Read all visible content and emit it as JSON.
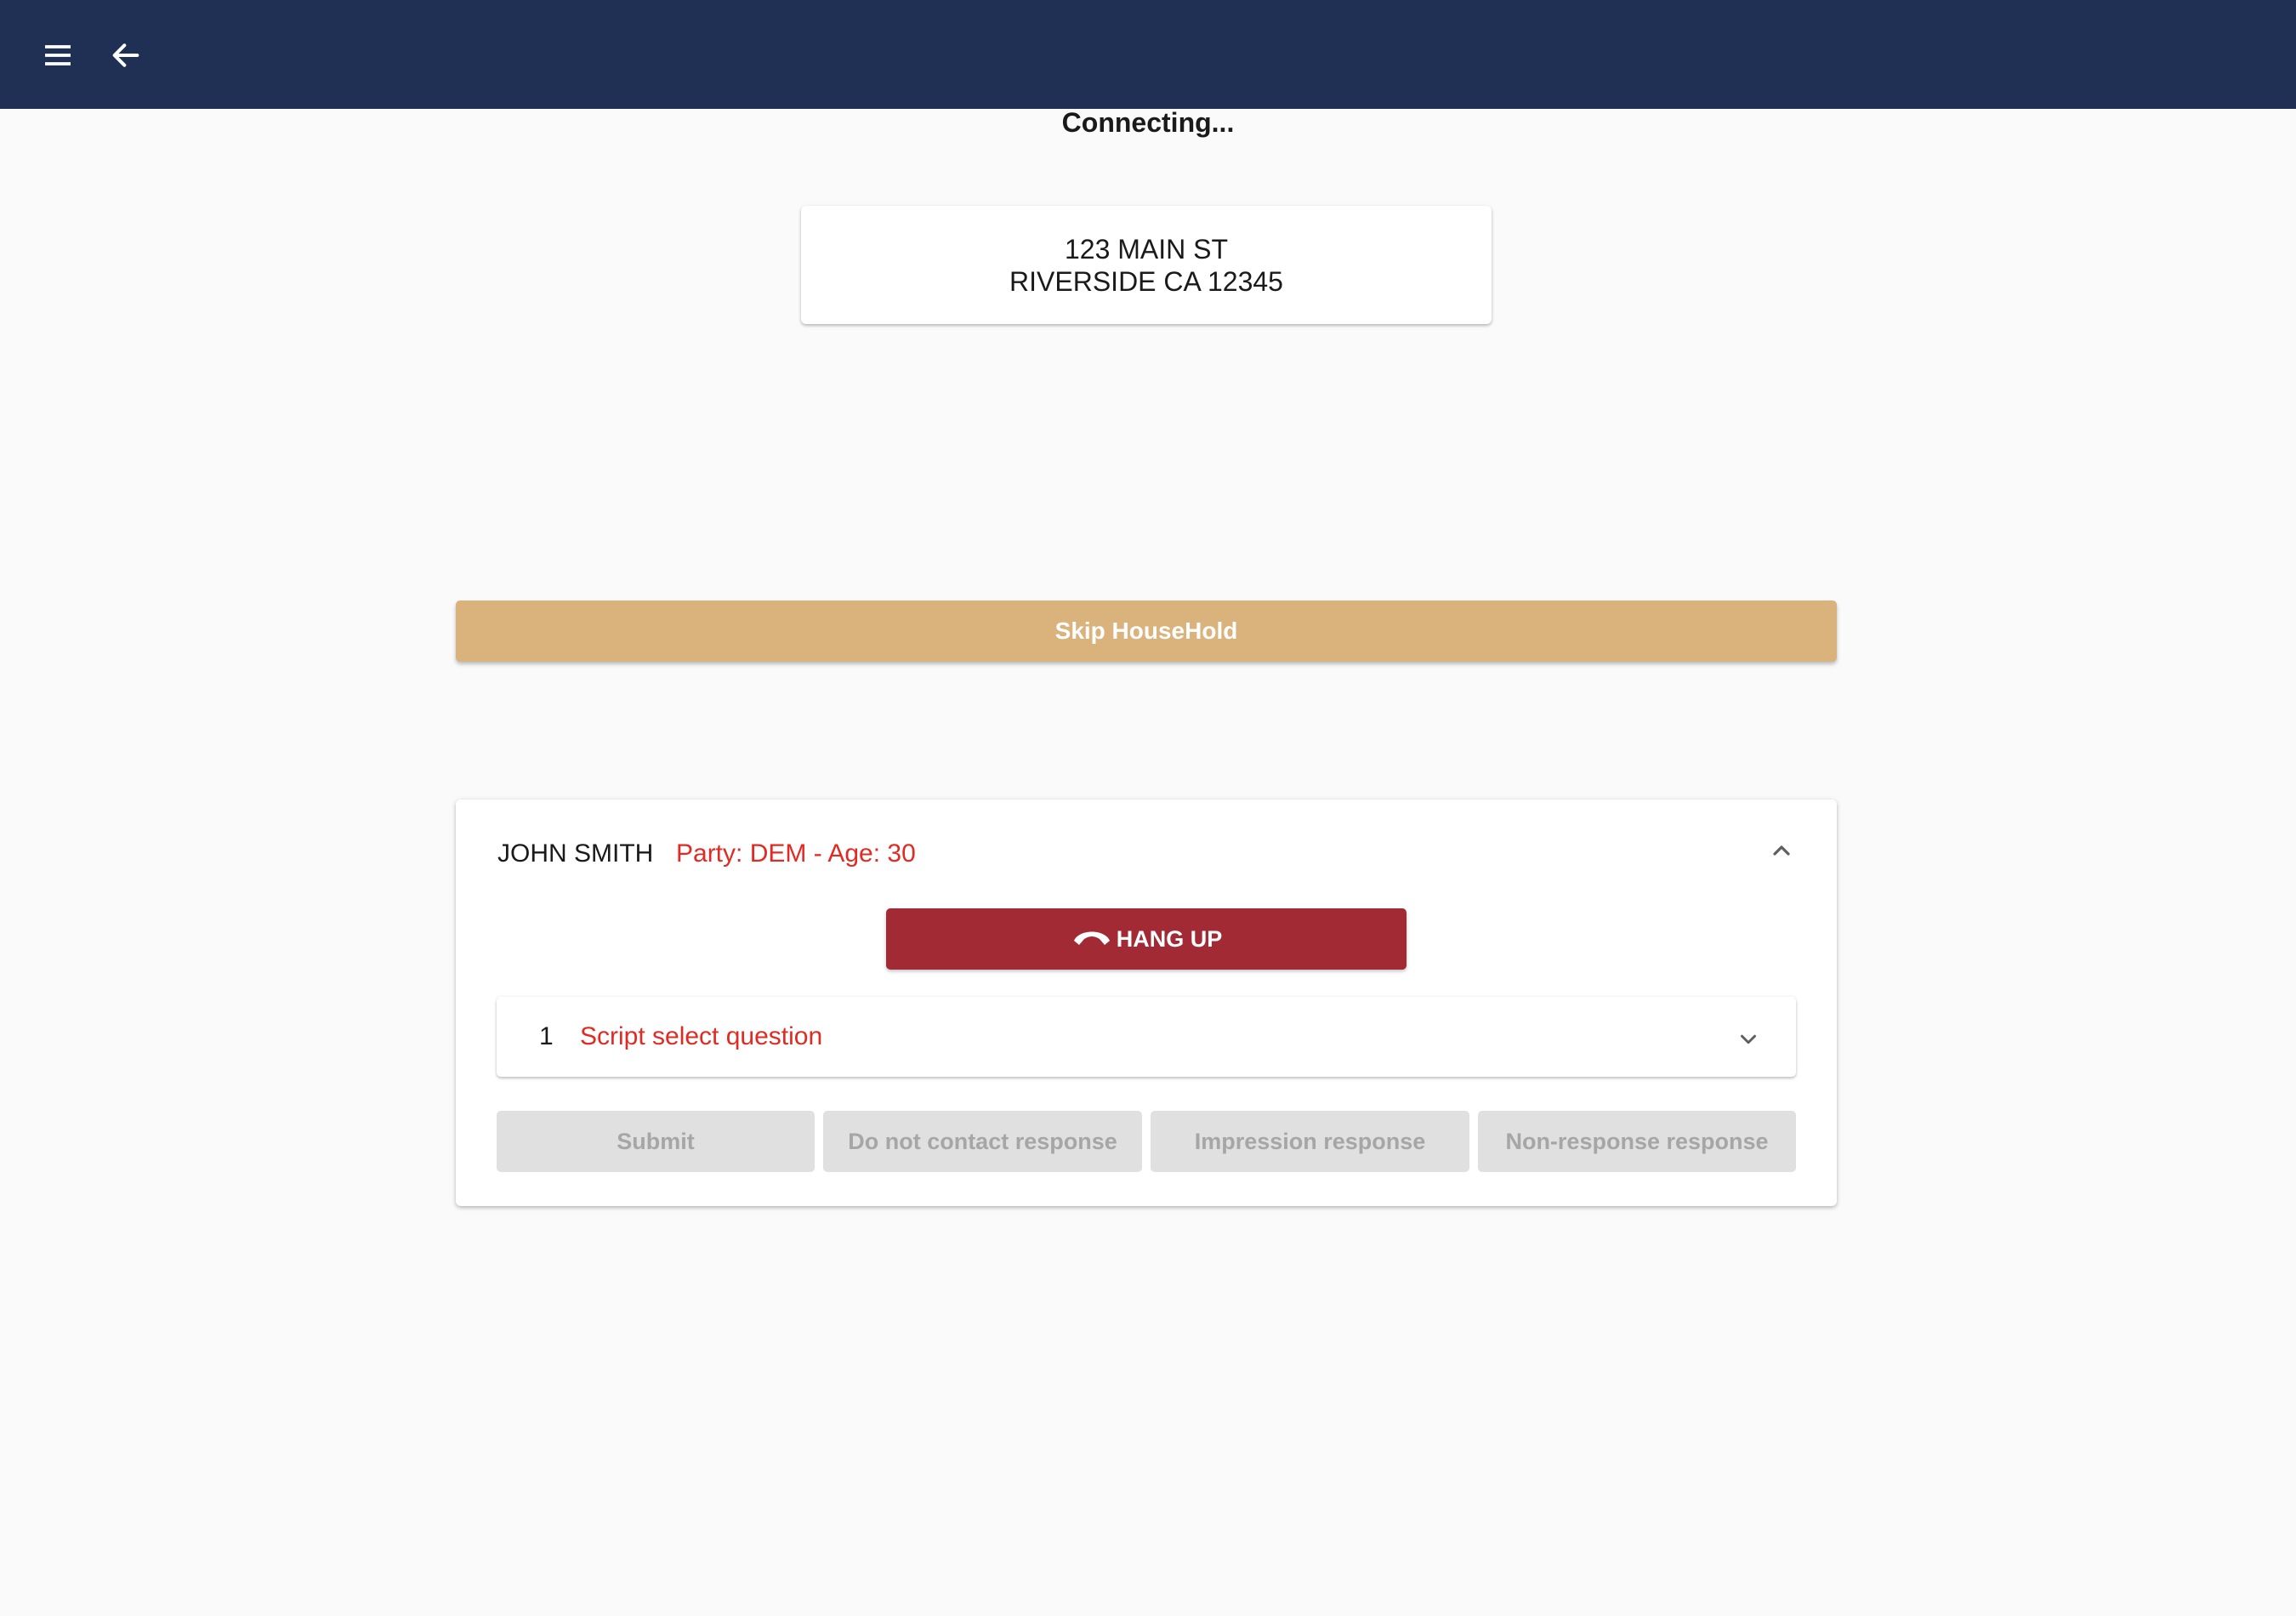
{
  "appbar": {
    "menu_icon": "menu-icon",
    "back_icon": "arrow-back-icon",
    "color": "#1f3054"
  },
  "status": "Connecting...",
  "address": {
    "line1": "123 MAIN ST",
    "line2": "RIVERSIDE CA 12345"
  },
  "skip_button": {
    "label": "Skip HouseHold",
    "color": "#d9b27c"
  },
  "voter": {
    "name": "JOHN SMITH",
    "meta": "Party: DEM - Age: 30",
    "collapse_icon": "chevron-up-icon",
    "hangup": {
      "label": "HANG UP",
      "icon": "phone-hangup-icon",
      "color": "#a22a35"
    },
    "question": {
      "number": "1",
      "text": "Script select question",
      "icon": "chevron-down-icon"
    },
    "actions": [
      {
        "label": "Submit"
      },
      {
        "label": "Do not contact response"
      },
      {
        "label": "Impression response"
      },
      {
        "label": "Non-response response"
      }
    ]
  },
  "colors": {
    "accent_red": "#e22a22",
    "disabled_bg": "#e0e0e0",
    "disabled_text": "#a6a6a6"
  }
}
